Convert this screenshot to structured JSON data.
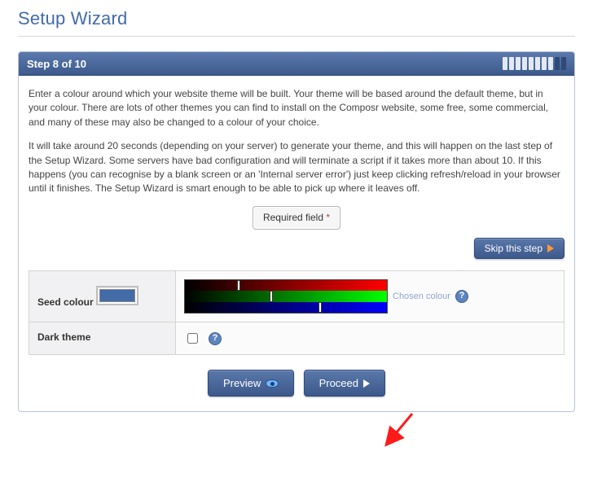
{
  "page_title": "Setup Wizard",
  "header": {
    "step_label": "Step 8 of 10",
    "total_steps": 10,
    "current_step": 8
  },
  "body": {
    "para1": "Enter a colour around which your website theme will be built. Your theme will be based around the default theme, but in your colour. There are lots of other themes you can find to install on the Composr website, some free, some commercial, and many of these may also be changed to a colour of your choice.",
    "para2": "It will take around 20 seconds (depending on your server) to generate your theme, and this will happen on the last step of the Setup Wizard. Some servers have bad configuration and will terminate a script if it takes more than about 10. If this happens (you can recognise by a blank screen or an 'Internal server error') just keep clicking refresh/reload in your browser until it finishes. The Setup Wizard is smart enough to be able to pick up where it leaves off.",
    "required_label": "Required field",
    "required_mark": "*",
    "skip_label": "Skip this step",
    "help_glyph": "?"
  },
  "form": {
    "seed": {
      "label": "Seed colour",
      "chosen_label": "Chosen colour",
      "value_hex": "#426ba8",
      "rgb_handles": {
        "r_pct": 26,
        "g_pct": 42,
        "b_pct": 66
      }
    },
    "dark": {
      "label": "Dark theme",
      "checked": false
    }
  },
  "actions": {
    "preview": "Preview",
    "proceed": "Proceed"
  }
}
